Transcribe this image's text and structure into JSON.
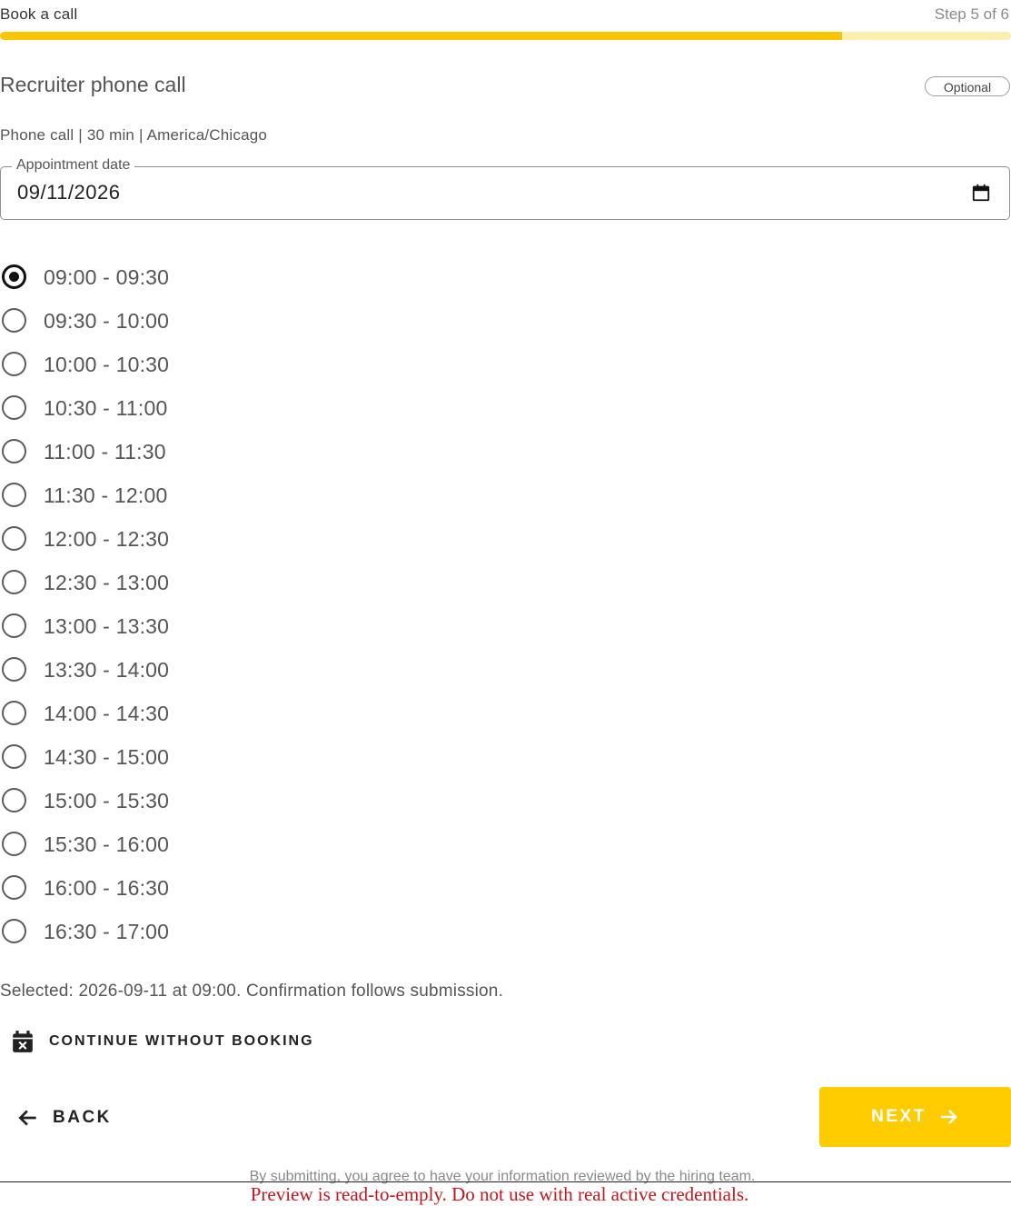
{
  "header": {
    "title": "Book a call",
    "step": "Step 5 of 6",
    "progress_fraction": 0.833,
    "progress_color": "#f7c600",
    "progress_track_color": "#fbefb0"
  },
  "section": {
    "title": "Recruiter phone call",
    "badge": "Optional",
    "meta": "Phone call | 30 min | America/Chicago"
  },
  "date_field": {
    "legend": "Appointment date",
    "value": "09/11/2026",
    "icon": "calendar-icon"
  },
  "slots": [
    {
      "label": "09:00 - 09:30",
      "selected": true
    },
    {
      "label": "09:30 - 10:00",
      "selected": false
    },
    {
      "label": "10:00 - 10:30",
      "selected": false
    },
    {
      "label": "10:30 - 11:00",
      "selected": false
    },
    {
      "label": "11:00 - 11:30",
      "selected": false
    },
    {
      "label": "11:30 - 12:00",
      "selected": false
    },
    {
      "label": "12:00 - 12:30",
      "selected": false
    },
    {
      "label": "12:30 - 13:00",
      "selected": false
    },
    {
      "label": "13:00 - 13:30",
      "selected": false
    },
    {
      "label": "13:30 - 14:00",
      "selected": false
    },
    {
      "label": "14:00 - 14:30",
      "selected": false
    },
    {
      "label": "14:30 - 15:00",
      "selected": false
    },
    {
      "label": "15:00 - 15:30",
      "selected": false
    },
    {
      "label": "15:30 - 16:00",
      "selected": false
    },
    {
      "label": "16:00 - 16:30",
      "selected": false
    },
    {
      "label": "16:30 - 17:00",
      "selected": false
    }
  ],
  "selected_text": "Selected: 2026-09-11 at 09:00. Confirmation follows submission.",
  "actions": {
    "continue_label": "CONTINUE WITHOUT BOOKING",
    "continue_icon": "calendar-remove-icon",
    "back_label": "BACK",
    "back_icon": "arrow-left-icon",
    "next_label": "NEXT",
    "next_icon": "arrow-right-icon",
    "next_color": "#ffcc00"
  },
  "footer": {
    "disclaimer": "By submitting, you agree to have your information reviewed by the hiring team.",
    "notice": "Preview is read-to-emply. Do not use with real active credentials."
  }
}
